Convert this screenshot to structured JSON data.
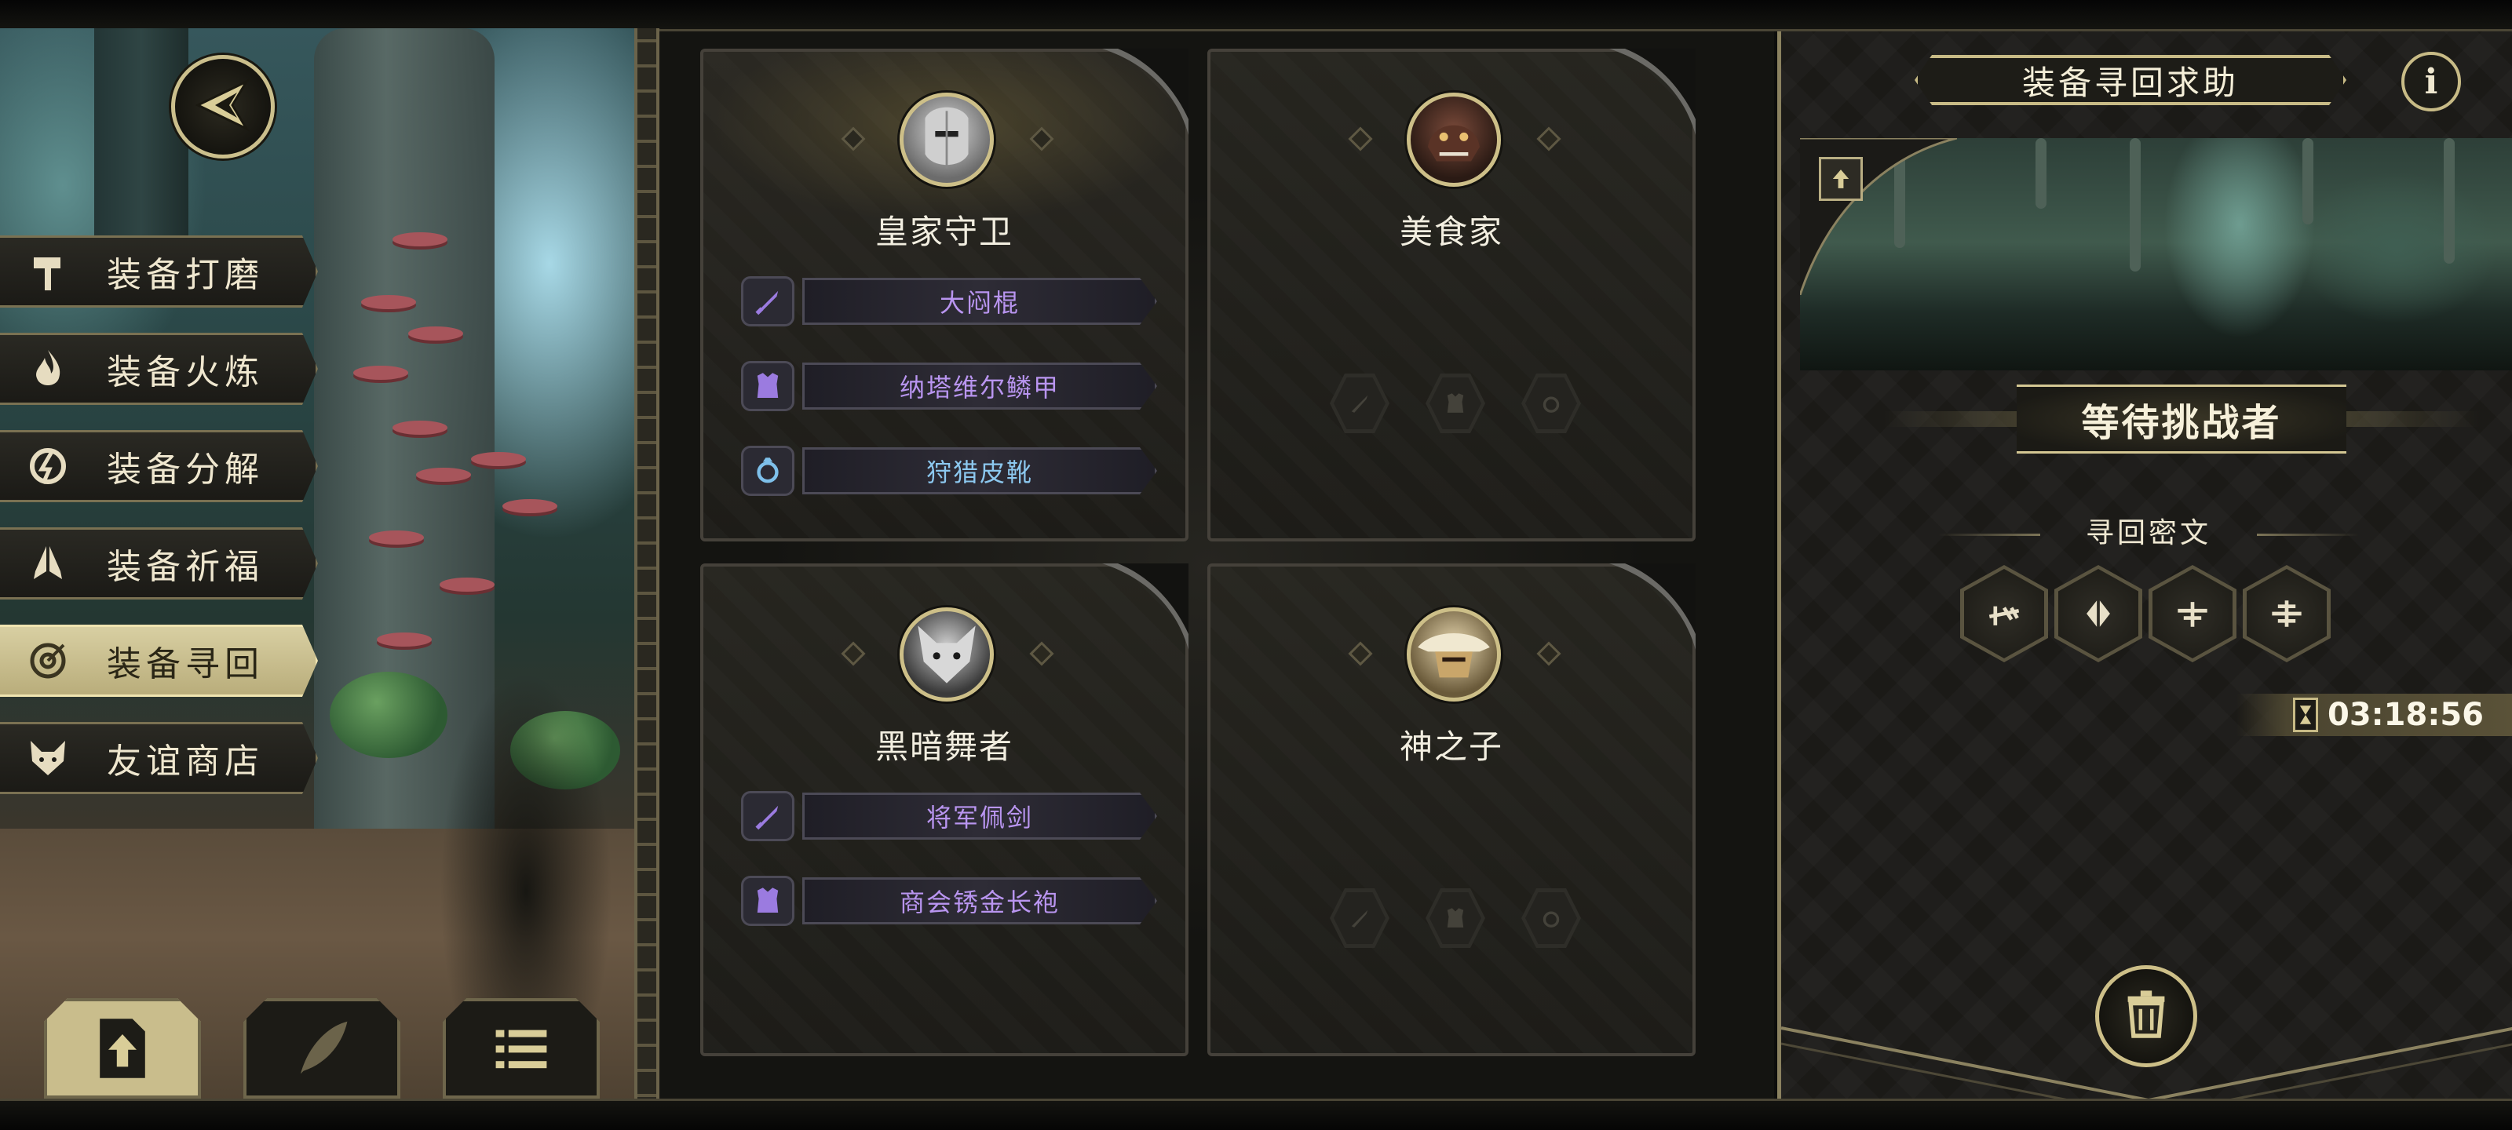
{
  "colors": {
    "gold": "#cdbf88",
    "panel": "#1b1a17",
    "purple_text": "#b995f0",
    "blue_text": "#8cc8ef",
    "active_menu": "#c9bd8c"
  },
  "back_button": {
    "icon": "back-arrow-icon"
  },
  "menu": [
    {
      "label": "装备打磨",
      "icon": "hammer-icon",
      "active": false
    },
    {
      "label": "装备火炼",
      "icon": "flame-icon",
      "active": false
    },
    {
      "label": "装备分解",
      "icon": "disassemble-icon",
      "active": false
    },
    {
      "label": "装备祈福",
      "icon": "praying-hands-icon",
      "active": false
    },
    {
      "label": "装备寻回",
      "icon": "target-icon",
      "active": true
    },
    {
      "label": "友谊商店",
      "icon": "fox-icon",
      "active": false
    }
  ],
  "bottom_tabs": [
    {
      "icon": "upload-doc-icon",
      "active": true
    },
    {
      "icon": "feather-icon",
      "active": false
    },
    {
      "icon": "list-icon",
      "active": false
    }
  ],
  "cards": [
    {
      "name": "皇家守卫",
      "portrait": "royal-guard-portrait",
      "items": [
        {
          "label": "大闷棍",
          "icon": "sword-icon",
          "rarity": "purple"
        },
        {
          "label": "纳塔维尔鳞甲",
          "icon": "armor-icon",
          "rarity": "purple"
        },
        {
          "label": "狩猎皮靴",
          "icon": "ring-icon",
          "rarity": "blue"
        }
      ]
    },
    {
      "name": "美食家",
      "portrait": "gourmet-portrait",
      "items": []
    },
    {
      "name": "黑暗舞者",
      "portrait": "dark-dancer-portrait",
      "items": [
        {
          "label": "将军佩剑",
          "icon": "sword-icon",
          "rarity": "purple"
        },
        {
          "label": "商会锈金长袍",
          "icon": "armor-icon",
          "rarity": "purple"
        }
      ]
    },
    {
      "name": "神之子",
      "portrait": "son-of-god-portrait",
      "items": []
    }
  ],
  "right_panel": {
    "title": "装备寻回求助",
    "info_icon": "i",
    "status": "等待挑战者",
    "cipher_title": "寻回密文",
    "runes": [
      "rune-1-icon",
      "rune-2-icon",
      "rune-3-icon",
      "rune-4-icon"
    ],
    "timer": "03:18:56",
    "trash_icon": "trash-icon"
  }
}
